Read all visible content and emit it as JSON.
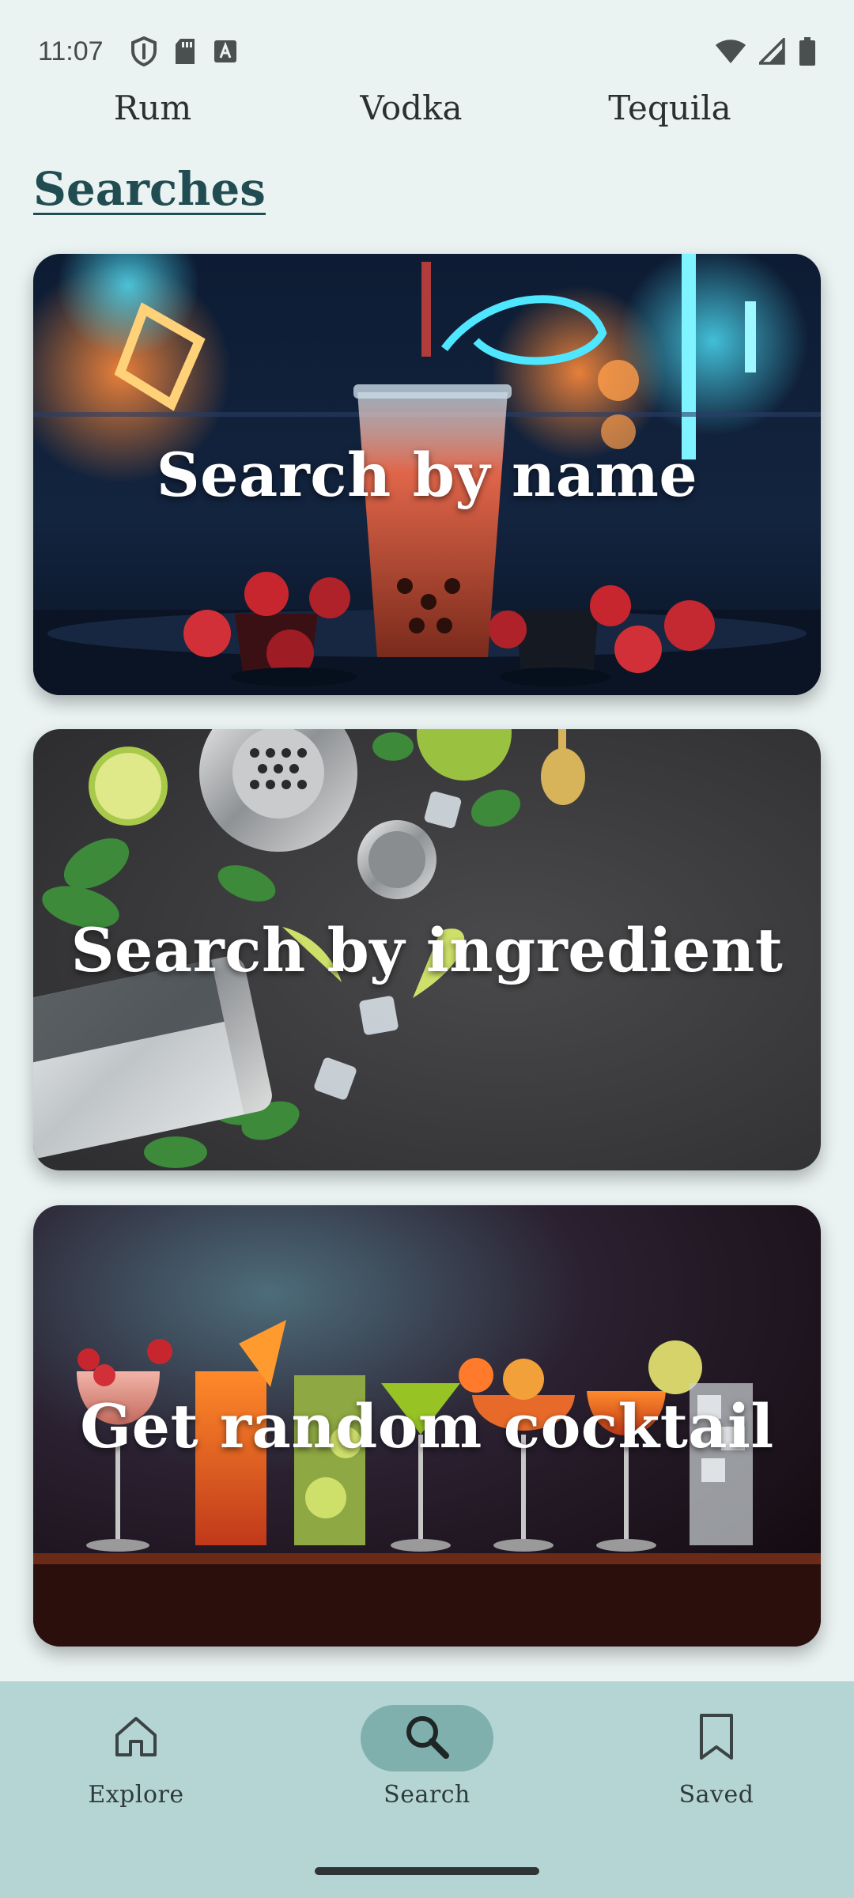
{
  "status_bar": {
    "time": "11:07",
    "left_icons": [
      "shield-icon",
      "sd-card-icon",
      "font-download-icon"
    ],
    "right_icons": [
      "wifi-icon",
      "cell-signal-icon",
      "battery-icon"
    ]
  },
  "categories": [
    "Rum",
    "Vodka",
    "Tequila"
  ],
  "section_title": "Searches",
  "cards": [
    {
      "label": "Search by name"
    },
    {
      "label": "Search by ingredient"
    },
    {
      "label": "Get random cocktail"
    }
  ],
  "bottom_nav": {
    "items": [
      {
        "label": "Explore",
        "icon": "home-icon",
        "active": false
      },
      {
        "label": "Search",
        "icon": "search-icon",
        "active": true
      },
      {
        "label": "Saved",
        "icon": "bookmark-icon",
        "active": false
      }
    ]
  },
  "colors": {
    "background": "#eaf3f2",
    "title": "#214d52",
    "nav_background": "#b5d5d4",
    "nav_active_pill": "#7fb0ae"
  }
}
